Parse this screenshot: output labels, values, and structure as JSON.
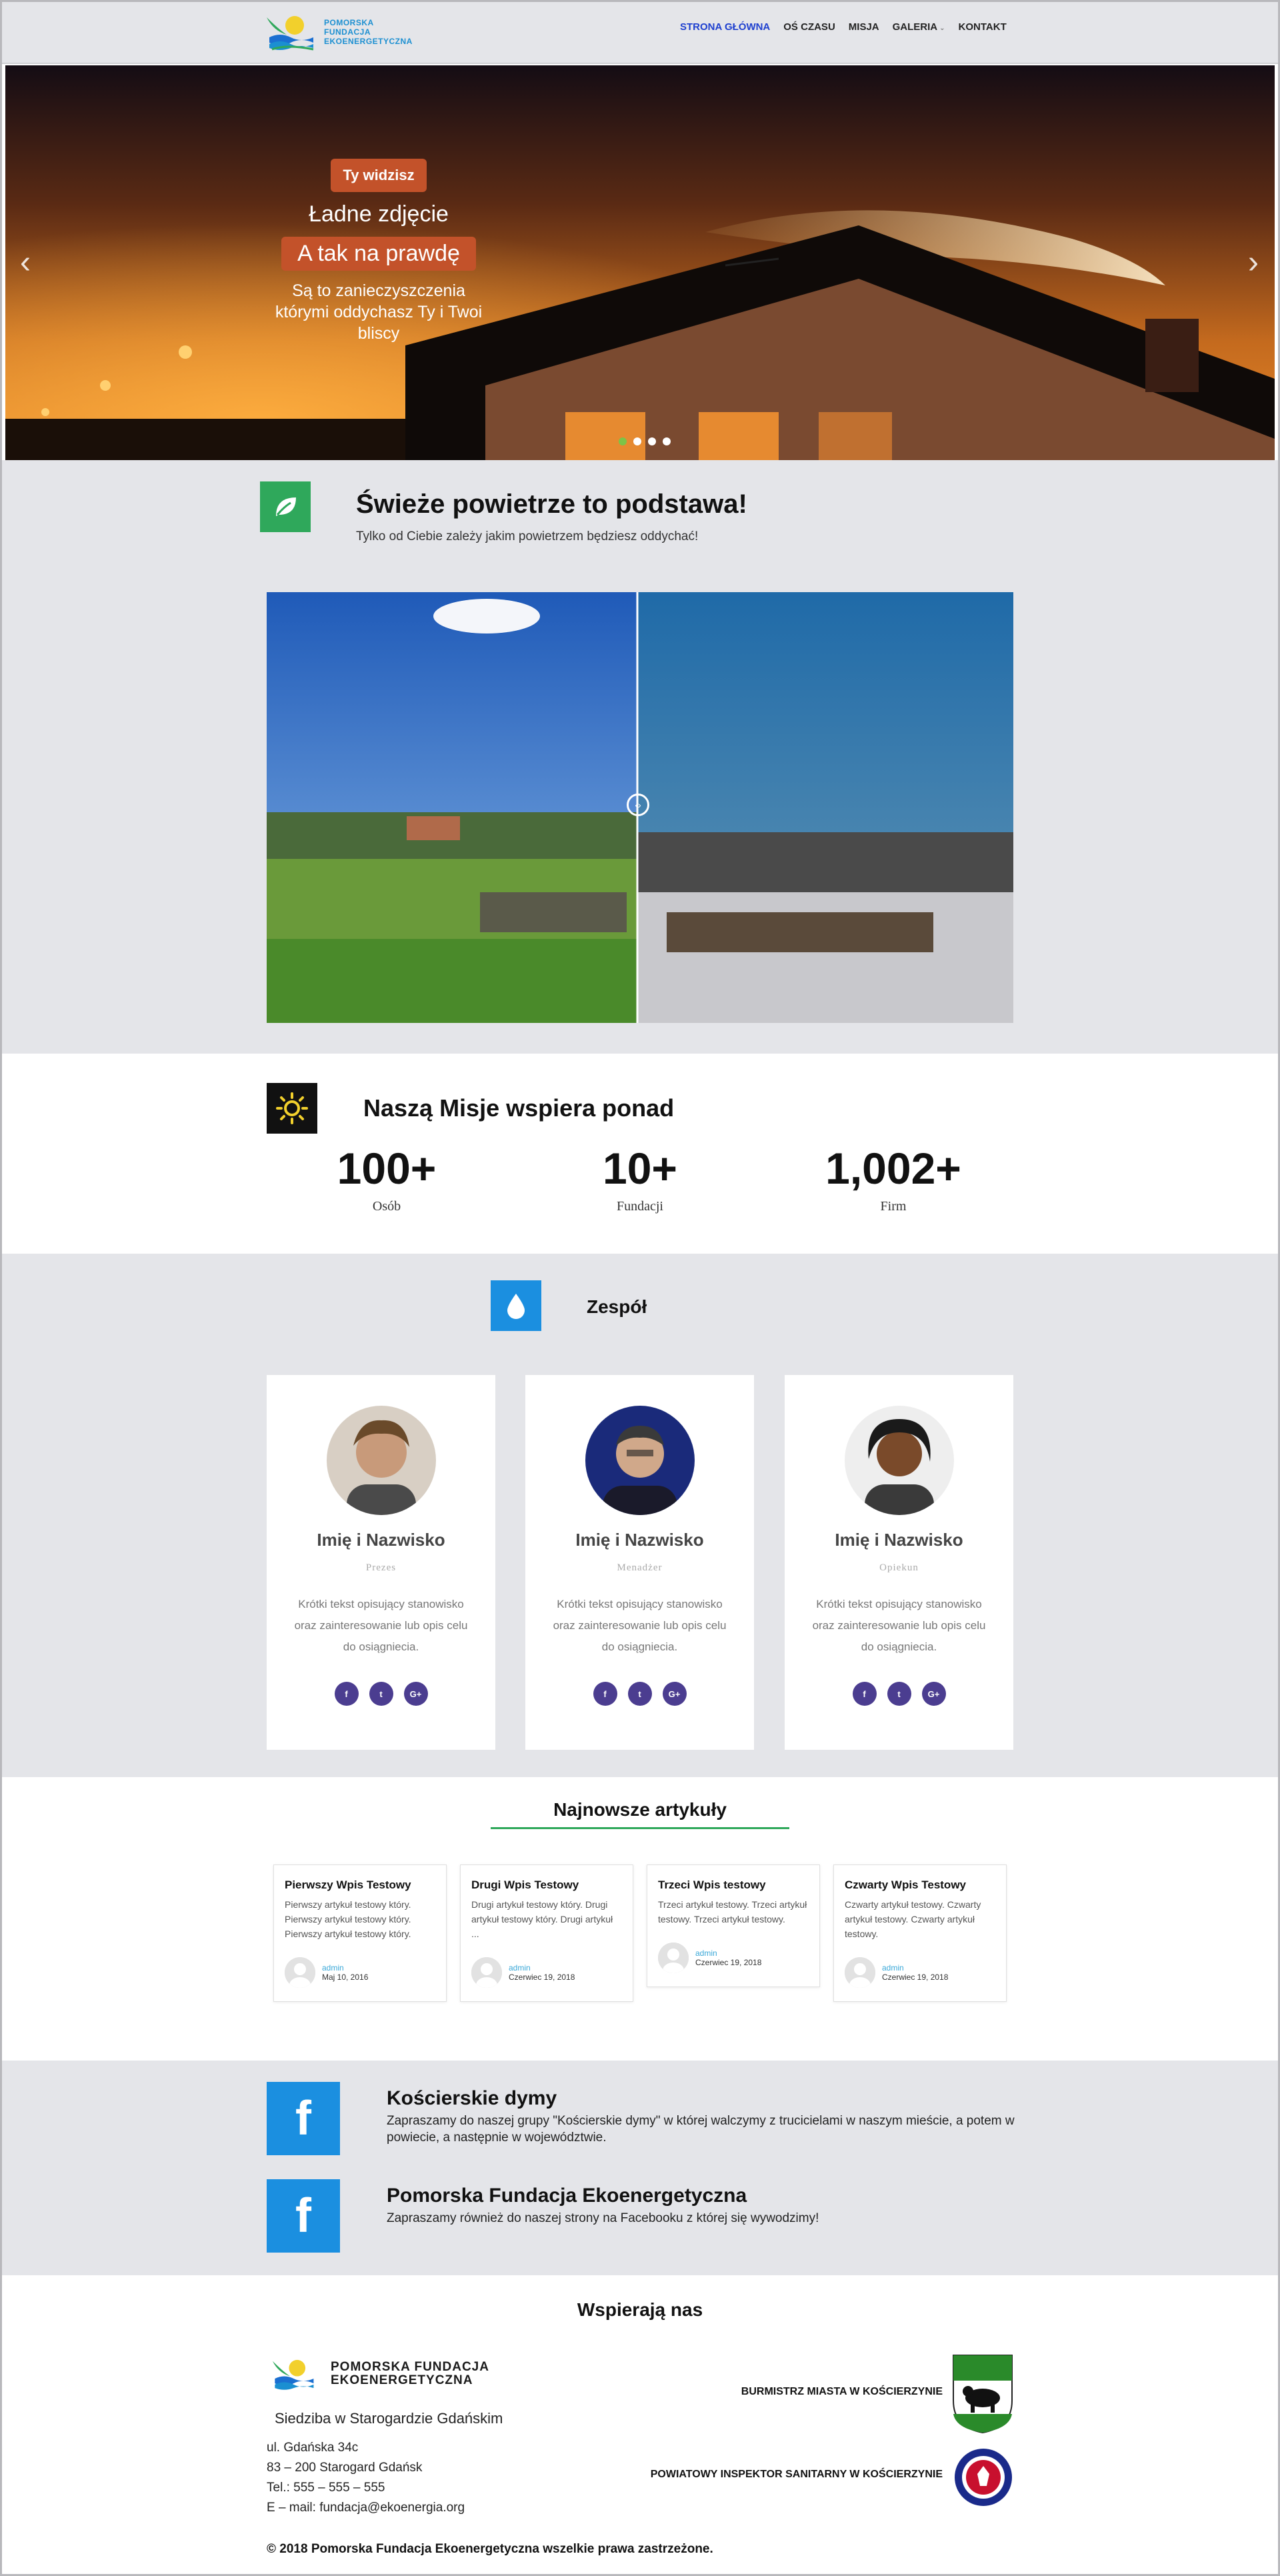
{
  "header": {
    "logo_lines": [
      "POMORSKA",
      "FUNDACJA",
      "EKOENERGETYCZNA"
    ],
    "nav": [
      {
        "label": "STRONA GŁÓWNA",
        "active": true
      },
      {
        "label": "OŚ CZASU",
        "active": false
      },
      {
        "label": "MISJA",
        "active": false
      },
      {
        "label": "GALERIA",
        "active": false,
        "has_dropdown": true
      },
      {
        "label": "KONTAKT",
        "active": false
      }
    ],
    "active_color": "#1d3fcf"
  },
  "hero": {
    "pill1": "Ty widzisz",
    "line1": "Ładne zdjęcie",
    "pill2": "A tak na prawdę",
    "line2": "Są to zanieczyszczenia którymi oddychasz Ty i Twoi bliscy",
    "prev_icon": "chevron-left-icon",
    "next_icon": "chevron-right-icon",
    "slide_count": 4,
    "active_slide": 1
  },
  "fresh": {
    "icon": "leaf-icon",
    "title": "Świeże powietrze to podstawa!",
    "subtitle": "Tylko od Ciebie zależy jakim powietrzem będziesz oddychać!",
    "handle_icon": "compare-arrows-icon"
  },
  "mission": {
    "icon": "sun-icon",
    "title": "Naszą Misje wspiera ponad",
    "stats": [
      {
        "value": "100+",
        "label": "Osób"
      },
      {
        "value": "10+",
        "label": "Fundacji"
      },
      {
        "value": "1,002+",
        "label": "Firm"
      }
    ]
  },
  "team": {
    "icon": "water-drop-icon",
    "title": "Zespół",
    "members": [
      {
        "name": "Imię i Nazwisko",
        "role": "Prezes",
        "desc": "Krótki tekst opisujący stanowisko oraz zainteresowanie lub opis celu do osiągniecia."
      },
      {
        "name": "Imię i Nazwisko",
        "role": "Menadżer",
        "desc": "Krótki tekst opisujący stanowisko oraz zainteresowanie lub opis celu do osiągniecia."
      },
      {
        "name": "Imię i Nazwisko",
        "role": "Opiekun",
        "desc": "Krótki tekst opisujący stanowisko oraz zainteresowanie lub opis celu do osiągniecia."
      }
    ],
    "social_labels": [
      "f",
      "t",
      "G+"
    ]
  },
  "articles": {
    "title": "Najnowsze artykuły",
    "items": [
      {
        "title": "Pierwszy Wpis Testowy",
        "excerpt": "Pierwszy artykuł testowy który. Pierwszy artykuł testowy który. Pierwszy artykuł testowy który.",
        "author": "admin",
        "date": "Maj 10, 2016"
      },
      {
        "title": "Drugi Wpis Testowy",
        "excerpt": "Drugi artykuł testowy który. Drugi artykuł testowy który. Drugi artykuł ...",
        "author": "admin",
        "date": "Czerwiec 19, 2018"
      },
      {
        "title": "Trzeci Wpis testowy",
        "excerpt": "Trzeci artykuł testowy. Trzeci artykuł testowy. Trzeci artykuł testowy.",
        "author": "admin",
        "date": "Czerwiec 19, 2018"
      },
      {
        "title": "Czwarty Wpis Testowy",
        "excerpt": "Czwarty artykuł testowy. Czwarty artykuł testowy. Czwarty artykuł testowy.",
        "author": "admin",
        "date": "Czerwiec 19, 2018"
      }
    ]
  },
  "facebook": {
    "icon_label": "f",
    "items": [
      {
        "title": "Kościerskie dymy",
        "text": "Zapraszamy do naszej grupy \"Kościerskie dymy\" w której walczymy z trucicielami w naszym mieście, a potem w powiecie, a następnie w województwie."
      },
      {
        "title": "Pomorska Fundacja Ekoenergetyczna",
        "text": "Zapraszamy również do naszej strony na Facebooku z której się wywodzimy!"
      }
    ],
    "color": "#1b8fe0"
  },
  "footer": {
    "title": "Wspierają nas",
    "logo_lines": [
      "POMORSKA FUNDACJA",
      "EKOENERGETYCZNA"
    ],
    "seat": "Siedziba w Starogardzie Gdańskim",
    "address": [
      "ul. Gdańska 34c",
      "83 – 200 Starogard Gdańsk",
      "Tel.: 555 – 555 – 555",
      "E – mail: fundacja@ekoenergia.org"
    ],
    "partners": [
      {
        "name": "BURMISTRZ MIASTA W KOŚCIERZYNIE",
        "icon": "bear-coat-of-arms-icon"
      },
      {
        "name": "POWIATOWY INSPEKTOR SANITARNY W KOŚCIERZYNIE",
        "icon": "sanitary-inspection-emblem-icon"
      }
    ],
    "copyright": "©  2018 Pomorska Fundacja Ekoenergetyczna wszelkie prawa zastrzeżone."
  }
}
